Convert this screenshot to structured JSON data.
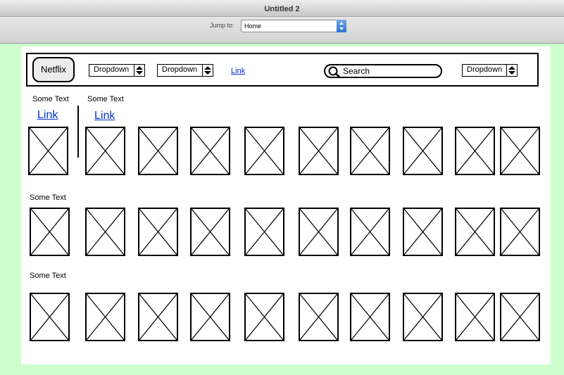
{
  "window": {
    "title": "Untitled 2"
  },
  "toolbar": {
    "jump_label": "Jump to:",
    "jump_value": "Home"
  },
  "header": {
    "logo": "Netflix",
    "dropdown1": "Dropdown",
    "dropdown2": "Dropdown",
    "link": "Link",
    "search_placeholder": "Search",
    "dropdown3": "Dropdown"
  },
  "rows": [
    {
      "sections": [
        {
          "text": "Some Text",
          "link": "Link"
        },
        {
          "text": "Some Text",
          "link": "Link"
        }
      ]
    },
    {
      "text": "Some Text"
    },
    {
      "text": "Some Text"
    }
  ],
  "icons": {
    "placeholder": "image-placeholder-icon",
    "search": "search-icon",
    "dropdown_arrow": "up-down-arrow-icon"
  }
}
